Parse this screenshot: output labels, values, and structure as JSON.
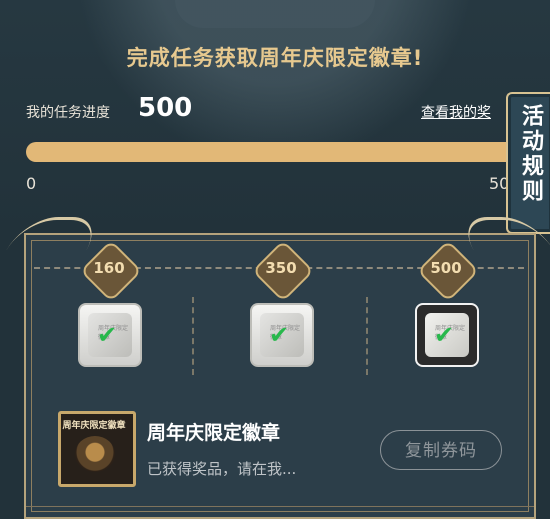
{
  "header": {
    "title": "完成任务获取周年庆限定徽章!"
  },
  "progress": {
    "label": "我的任务进度",
    "value": "500",
    "view_rewards_link": "查看我的奖",
    "fraction": 1.0,
    "tick_start": "0",
    "tick_end": "50"
  },
  "rules_tab": {
    "label": "活动规则"
  },
  "milestones": [
    {
      "label": "160",
      "reward_text": "周年庆限定徽章",
      "checked": true
    },
    {
      "label": "350",
      "reward_text": "周年庆限定徽章",
      "checked": true
    },
    {
      "label": "500",
      "reward_text": "周年庆限定徽章",
      "checked": true
    }
  ],
  "reward": {
    "thumb_title": "周年庆限定徽章",
    "name": "周年庆限定徽章",
    "status": "已获得奖品，请在我...",
    "copy_button": "复制券码"
  },
  "colors": {
    "background": "#22323a",
    "accent_gold": "#e2b877",
    "check_green": "#28b84c"
  },
  "icons": {
    "check": "check-icon",
    "badge": "badge-thumbnail"
  }
}
